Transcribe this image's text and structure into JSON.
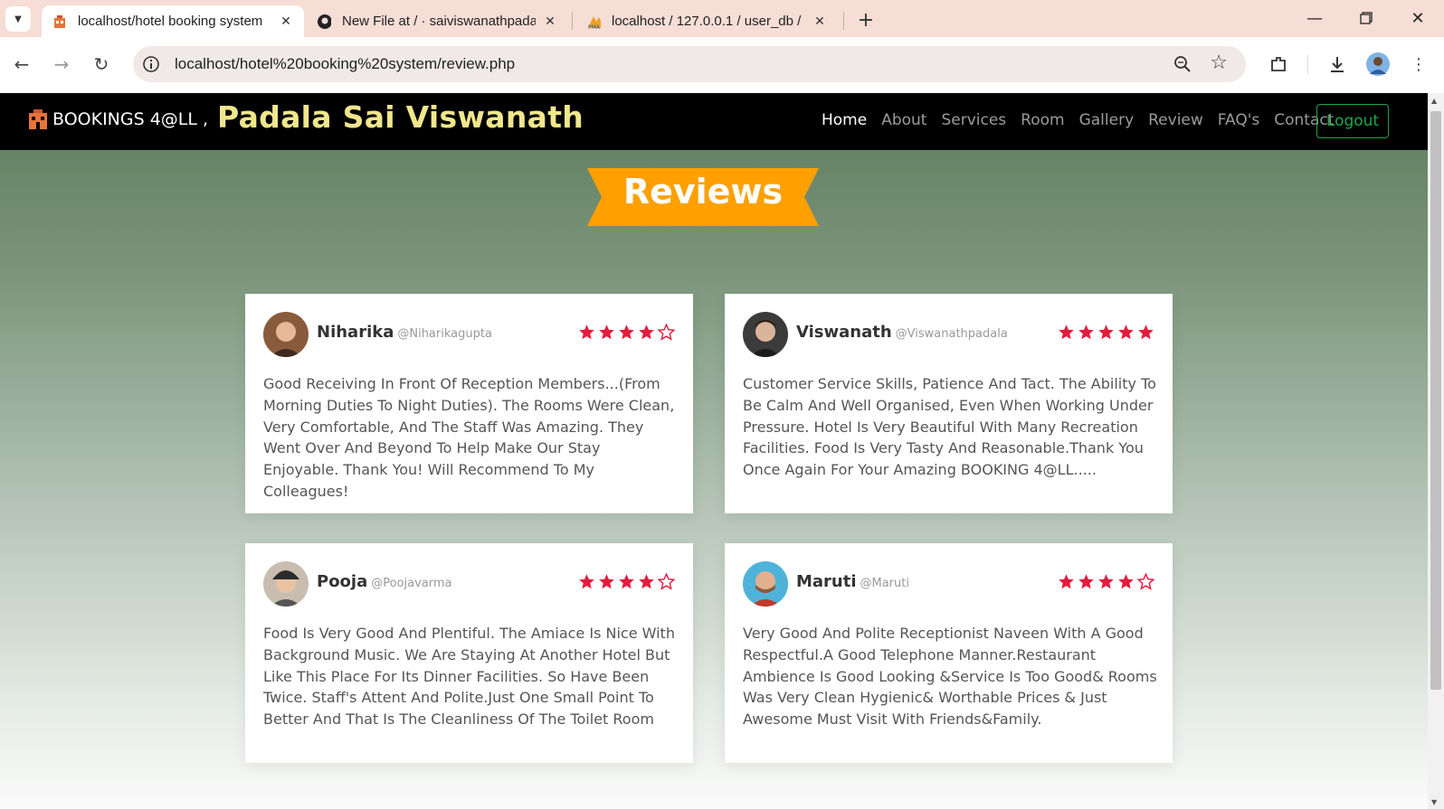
{
  "browser": {
    "tabs": [
      {
        "title": "localhost/hotel booking system"
      },
      {
        "title": "New File at / · saiviswanathpadala"
      },
      {
        "title": "localhost / 127.0.0.1 / user_db / "
      }
    ],
    "new_tab_label": "+",
    "url": "localhost/hotel%20booking%20system/review.php"
  },
  "navbar": {
    "brand": "BOOKINGS 4@LL ,",
    "username": "Padala Sai Viswanath",
    "links": [
      "Home",
      "About",
      "Services",
      "Room",
      "Gallery",
      "Review",
      "FAQ's",
      "Contact"
    ],
    "logout": "Logout"
  },
  "section": {
    "title": "Reviews"
  },
  "reviews": [
    {
      "name": "Niharika",
      "handle": "@Niharikagupta",
      "rating": 4,
      "text": "Good Receiving In Front Of Reception Members...(From Morning Duties To Night Duties). The Rooms Were Clean, Very Comfortable, And The Staff Was Amazing. They Went Over And Beyond To Help Make Our Stay Enjoyable. Thank You! Will Recommend To My Colleagues!"
    },
    {
      "name": "Viswanath",
      "handle": "@Viswanathpadala",
      "rating": 5,
      "text": "Customer Service Skills, Patience And Tact. The Ability To Be Calm And Well Organised, Even When Working Under Pressure. Hotel Is Very Beautiful With Many Recreation Facilities. Food Is Very Tasty And Reasonable.Thank You Once Again For Your Amazing BOOKING 4@LL....."
    },
    {
      "name": "Pooja",
      "handle": "@Poojavarma",
      "rating": 4,
      "text": "Food Is Very Good And Plentiful. The Amiace Is Nice With Background Music. We Are Staying At Another Hotel But Like This Place For Its Dinner Facilities. So Have Been Twice. Staff's Attent And Polite.Just One Small Point To Better And That Is The Cleanliness Of The Toilet Room"
    },
    {
      "name": "Maruti",
      "handle": "@Maruti",
      "rating": 4,
      "text": "Very Good And Polite Receptionist Naveen With A Good Respectful.A Good Telephone Manner.Restaurant Ambience Is Good Looking &Service Is Too Good& Rooms Was Very Clean Hygienic& Worthable Prices & Just Awesome Must Visit With Friends&Family."
    }
  ],
  "colors": {
    "star": "#e31c3d",
    "ribbon": "#ffa000",
    "username": "#f0e68c",
    "logout": "#1ea84a"
  }
}
